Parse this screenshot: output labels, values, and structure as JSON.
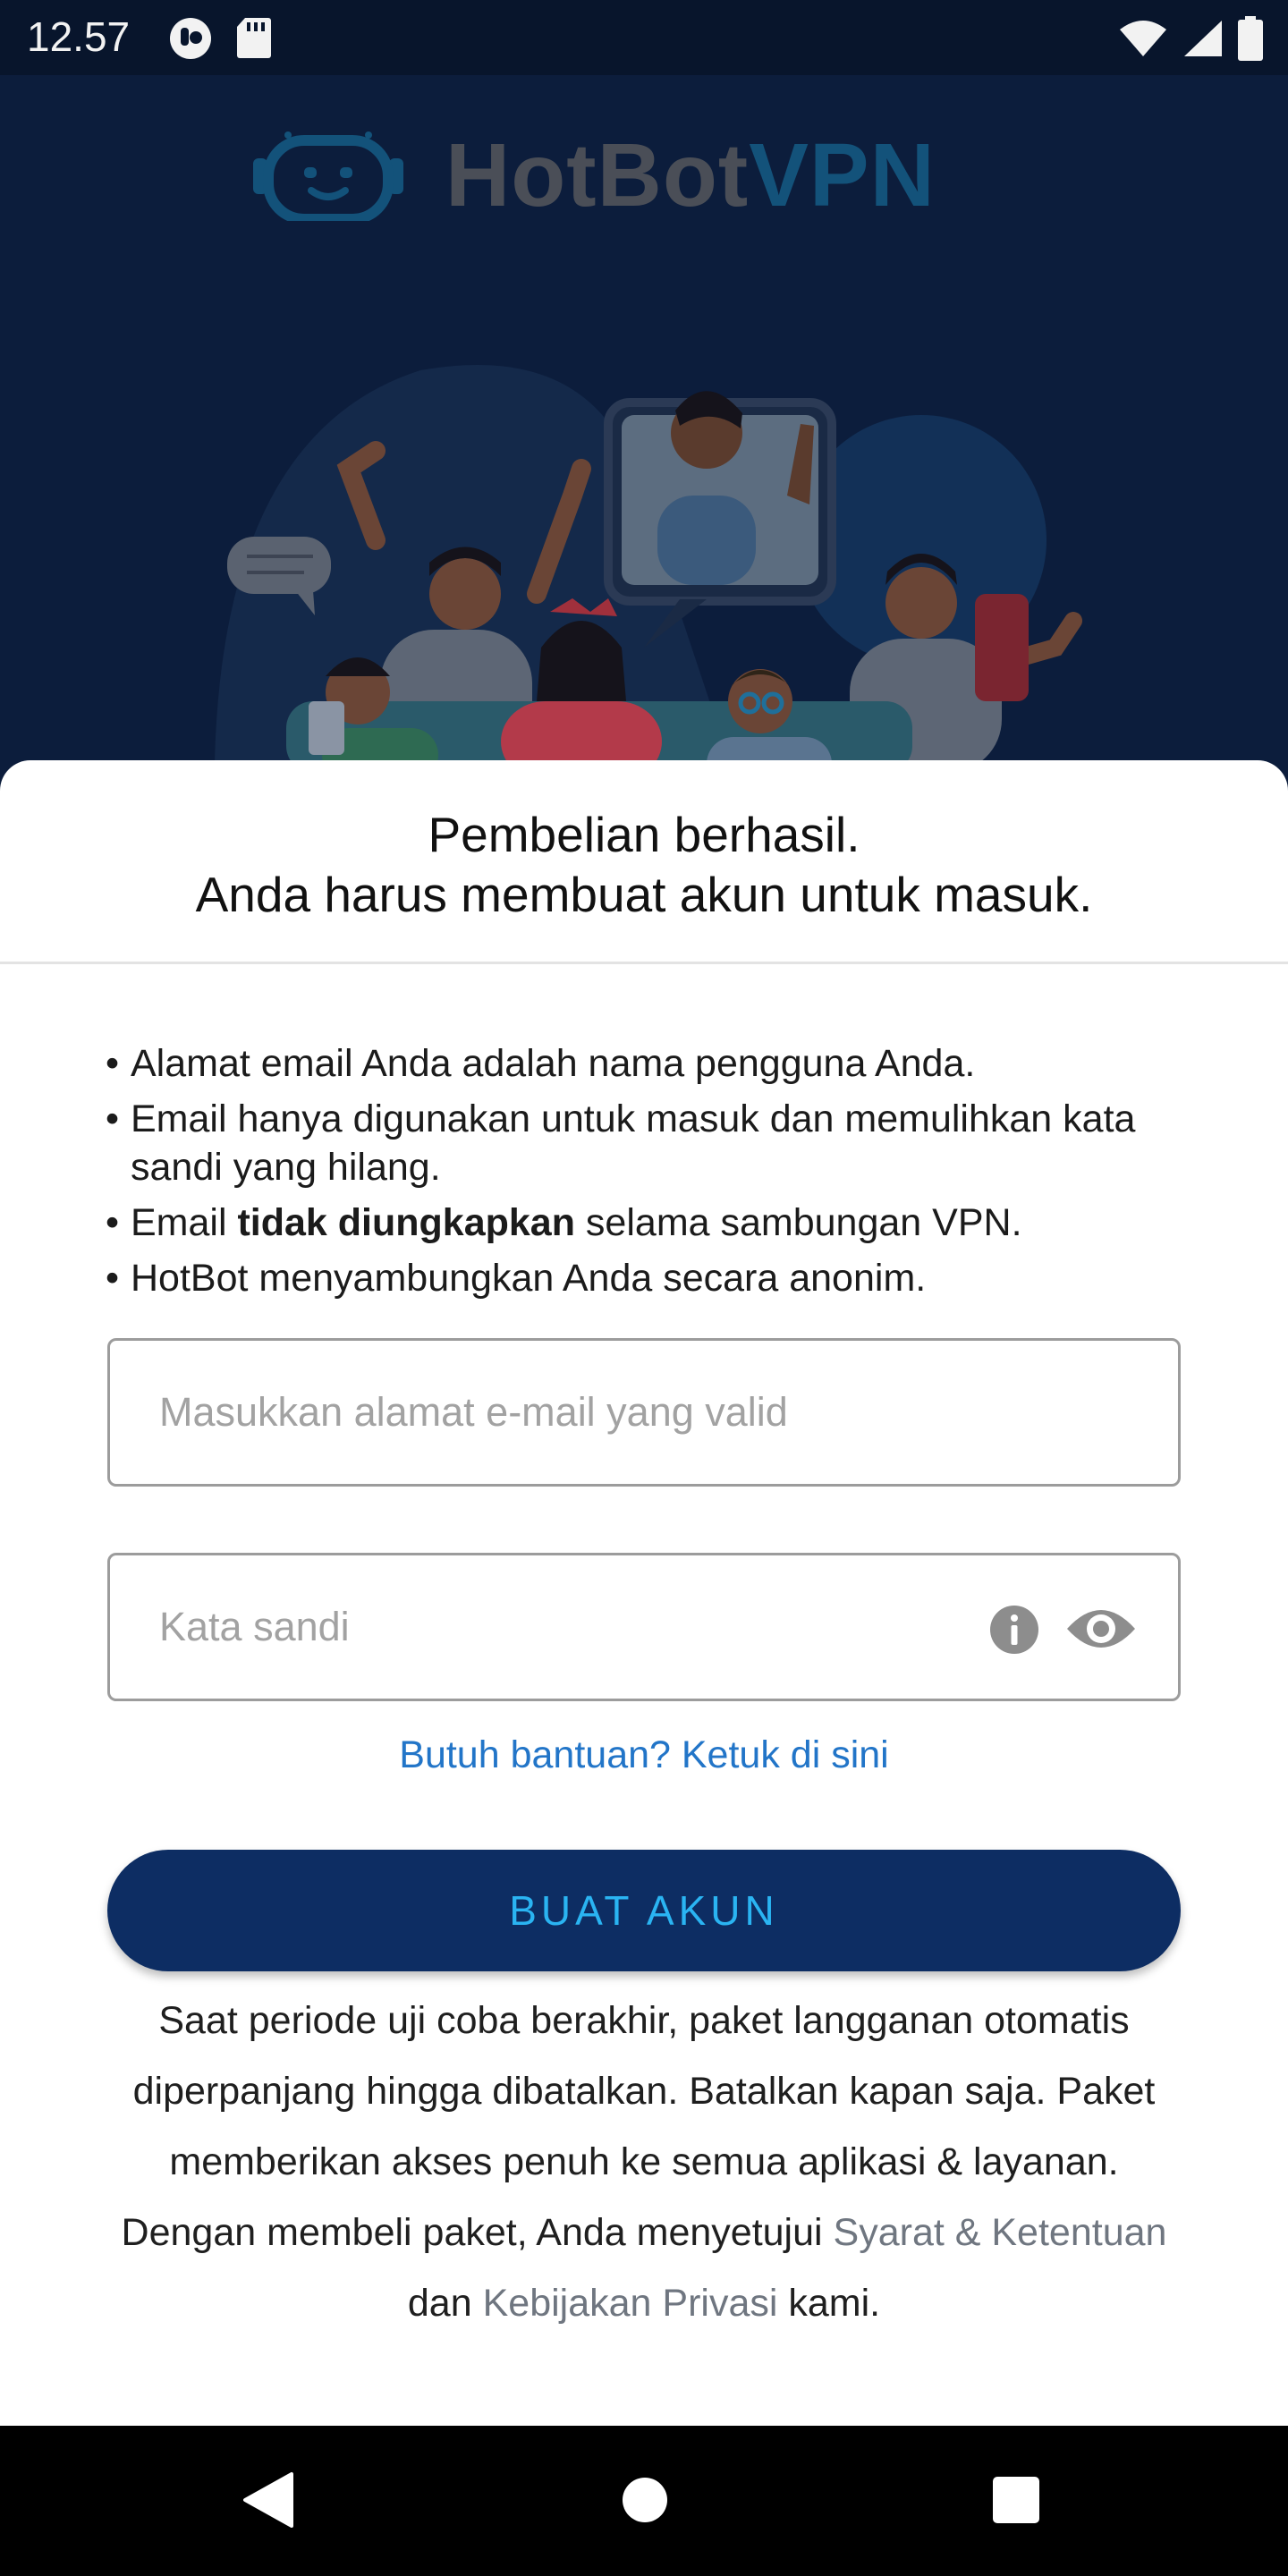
{
  "status_bar": {
    "time": "12.57"
  },
  "hero": {
    "brand_main": "HotBot",
    "brand_accent": "VPN"
  },
  "sheet": {
    "title_line1": "Pembelian berhasil.",
    "title_line2": "Anda harus membuat akun untuk masuk.",
    "bullets": {
      "b1": "Alamat email Anda adalah nama pengguna Anda.",
      "b2": "Email hanya digunakan untuk masuk dan memulihkan kata sandi yang hilang.",
      "b3_pre": "Email ",
      "b3_bold": "tidak diungkapkan",
      "b3_post": " selama sambungan VPN.",
      "b4": "HotBot menyambungkan Anda secara anonim."
    },
    "email": {
      "value": "",
      "placeholder": "Masukkan alamat e-mail yang valid"
    },
    "password": {
      "value": "",
      "placeholder": "Kata sandi"
    },
    "help_link": "Butuh bantuan? Ketuk di sini",
    "create_button": "BUAT AKUN",
    "legal": {
      "text1": "Saat periode uji coba berakhir, paket langganan otomatis diperpanjang hingga dibatalkan. Batalkan kapan saja. Paket memberikan akses penuh ke semua aplikasi & layanan. Dengan membeli paket, Anda menyetujui ",
      "terms_link": "Syarat & Ketentuan",
      "text2": " dan ",
      "privacy_link": "Kebijakan Privasi",
      "text3": " kami."
    }
  },
  "colors": {
    "hero_bg": "#0c1d3c",
    "button_bg": "#0d2d63",
    "button_text": "#2ab4f2",
    "link": "#2275c8"
  },
  "icons": [
    "signal-app-icon",
    "sd-card-icon",
    "wifi-icon",
    "cell-signal-icon",
    "battery-icon",
    "hotbot-robot-logo",
    "info-icon",
    "eye-icon",
    "back-icon",
    "home-icon",
    "recents-icon"
  ]
}
